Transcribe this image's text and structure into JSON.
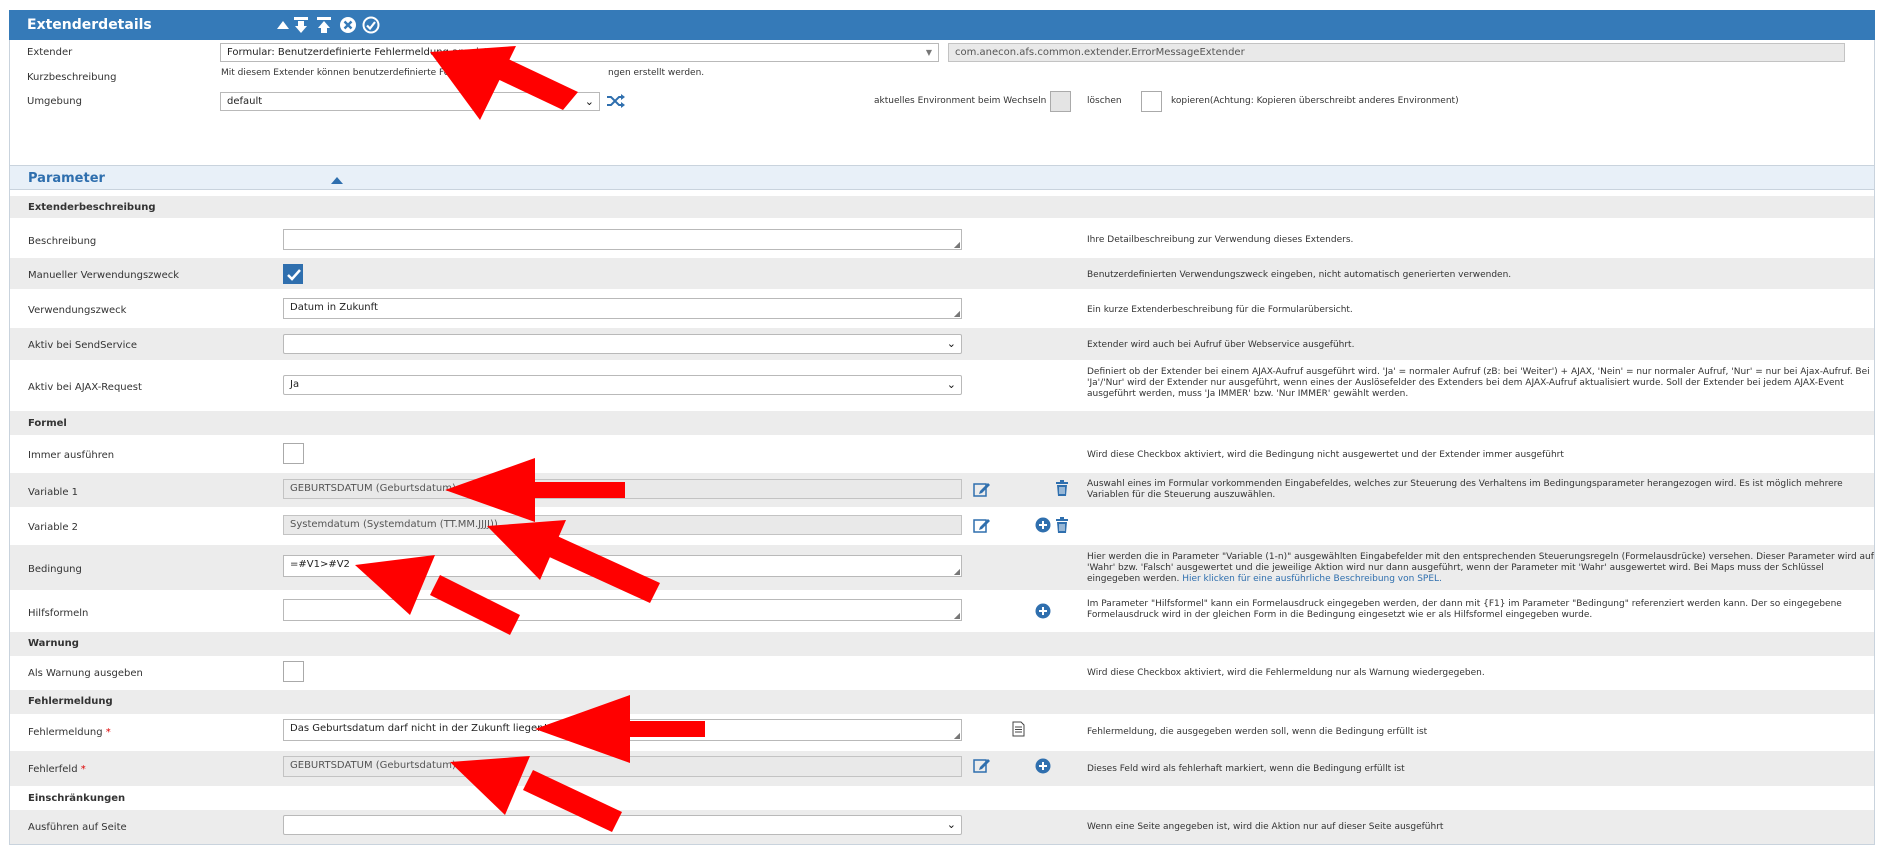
{
  "header": {
    "title": "Extenderdetails"
  },
  "top": {
    "extender_label": "Extender",
    "extender_value": "Formular: Benutzerdefinierte Fehlermeldung anzeigen",
    "extender_class": "com.anecon.afs.common.extender.ErrorMessageExtender",
    "kurz_label": "Kurzbeschreibung",
    "kurz_text_a": "Mit diesem Extender können benutzerdefinierte Fehlermeldungen au",
    "kurz_text_b": "ngen erstellt werden.",
    "umgebung_label": "Umgebung",
    "umgebung_value": "default",
    "env_switch_label": "aktuelles Environment beim Wechseln",
    "loeschen_label": "löschen",
    "kopieren_label": "kopieren(Achtung: Kopieren überschreibt anderes Environment)"
  },
  "parameter": {
    "title": "Parameter"
  },
  "groups": {
    "g1": "Extenderbeschreibung",
    "g2": "Formel",
    "g3": "Warnung",
    "g4": "Fehlermeldung",
    "g5": "Einschränkungen"
  },
  "rows": {
    "beschreibung": {
      "label": "Beschreibung",
      "value": "",
      "desc": "Ihre Detailbeschreibung zur Verwendung dieses Extenders."
    },
    "manuell": {
      "label": "Manueller Verwendungszweck",
      "checked": true,
      "desc": "Benutzerdefinierten Verwendungszweck eingeben, nicht automatisch generierten verwenden."
    },
    "verwendungszweck": {
      "label": "Verwendungszweck",
      "value": "Datum in Zukunft",
      "desc": "Ein kurze Extenderbeschreibung für die Formularübersicht."
    },
    "sendservice": {
      "label": "Aktiv bei SendService",
      "value": "",
      "desc": "Extender wird auch bei Aufruf über Webservice ausgeführt."
    },
    "ajax": {
      "label": "Aktiv bei AJAX-Request",
      "value": "Ja",
      "desc": "Definiert ob der Extender bei einem AJAX-Aufruf ausgeführt wird. 'Ja' = normaler Aufruf (zB: bei 'Weiter') + AJAX, 'Nein' = nur normaler Aufruf, 'Nur' = nur bei Ajax-Aufruf. Bei 'Ja'/'Nur' wird der Extender nur ausgeführt, wenn eines der Auslösefelder des Extenders bei dem AJAX-Aufruf aktualisiert wurde. Soll der Extender bei jedem AJAX-Event ausgeführt werden, muss 'Ja IMMER' bzw. 'Nur IMMER' gewählt werden."
    },
    "immer": {
      "label": "Immer ausführen",
      "checked": false,
      "desc": "Wird diese Checkbox aktiviert, wird die Bedingung nicht ausgewertet und der Extender immer ausgeführt"
    },
    "var1": {
      "label": "Variable 1",
      "value": "GEBURTSDATUM (Geburtsdatum)",
      "desc": "Auswahl eines im Formular vorkommenden Eingabefeldes, welches zur Steuerung des Verhaltens im Bedingungsparameter herangezogen wird. Es ist möglich mehrere Variablen für die Steuerung auszuwählen."
    },
    "var2": {
      "label": "Variable 2",
      "value": "Systemdatum (Systemdatum (TT.MM.JJJJ))",
      "desc": ""
    },
    "bedingung": {
      "label": "Bedingung",
      "value": "=#V1>#V2",
      "desc": "Hier werden die in Parameter \"Variable (1-n)\" ausgewählten Eingabefelder mit den entsprechenden Steuerungsregeln (Formelausdrücke) versehen. Dieser Parameter wird auf 'Wahr' bzw. 'Falsch' ausgewertet und die jeweilige Aktion wird nur dann ausgeführt, wenn der Parameter mit 'Wahr' ausgewertet wird. Bei Maps muss der Schlüssel eingegeben werden.",
      "link": "Hier klicken für eine ausführliche Beschreibung von SPEL."
    },
    "hilfsformeln": {
      "label": "Hilfsformeln",
      "value": "",
      "desc": "Im Parameter \"Hilfsformel\" kann ein Formelausdruck eingegeben werden, der dann mit {F1} im Parameter \"Bedingung\" referenziert werden kann. Der so eingegebene Formelausdruck wird in der gleichen Form in die Bedingung eingesetzt wie er als Hilfsformel eingegeben wurde."
    },
    "warnung": {
      "label": "Als Warnung ausgeben",
      "checked": false,
      "desc": "Wird diese Checkbox aktiviert, wird die Fehlermeldung nur als Warnung wiedergegeben."
    },
    "fehlermeldung": {
      "label": "Fehlermeldung",
      "value": "Das Geburtsdatum darf nicht in der Zukunft liegen!",
      "desc": "Fehlermeldung, die ausgegeben werden soll, wenn die Bedingung erfüllt ist"
    },
    "fehlerfeld": {
      "label": "Fehlerfeld",
      "value": "GEBURTSDATUM (Geburtsdatum)",
      "desc": "Dieses Feld wird als fehlerhaft markiert, wenn die Bedingung erfüllt ist"
    },
    "seite": {
      "label": "Ausführen auf Seite",
      "value": "",
      "desc": "Wenn eine Seite angegeben ist, wird die Aktion nur auf dieser Seite ausgeführt"
    }
  },
  "required_mark": "*",
  "colors": {
    "header": "#357ab8",
    "accent": "#2f6fae",
    "annotation": "#ff0000"
  }
}
